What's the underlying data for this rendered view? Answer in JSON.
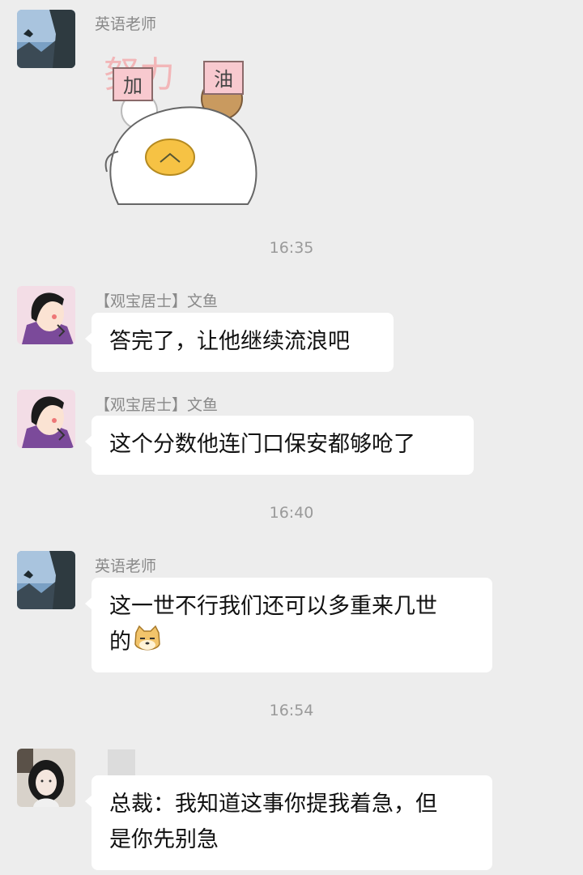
{
  "messages": [
    {
      "sender": "英语老师",
      "sticker": {
        "left_sign": "加",
        "right_sign": "油"
      }
    },
    {
      "time": "16:35"
    },
    {
      "sender": "【观宝居士】文鱼",
      "text": "答完了，让他继续流浪吧"
    },
    {
      "sender": "【观宝居士】文鱼",
      "text": "这个分数他连门口保安都够呛了"
    },
    {
      "time": "16:40"
    },
    {
      "sender": "英语老师",
      "line1": "这一世不行我们还可以多重来几世",
      "line2": "的",
      "emoji": "doge-emoji"
    },
    {
      "time": "16:54"
    },
    {
      "sender": "",
      "line1": "总裁：我知道这事你提我着急，但",
      "line2": "是你先别急"
    }
  ],
  "colors": {
    "background": "#ededed",
    "bubble": "#ffffff",
    "name": "#8a8a8a",
    "time": "#9a9a9a"
  }
}
